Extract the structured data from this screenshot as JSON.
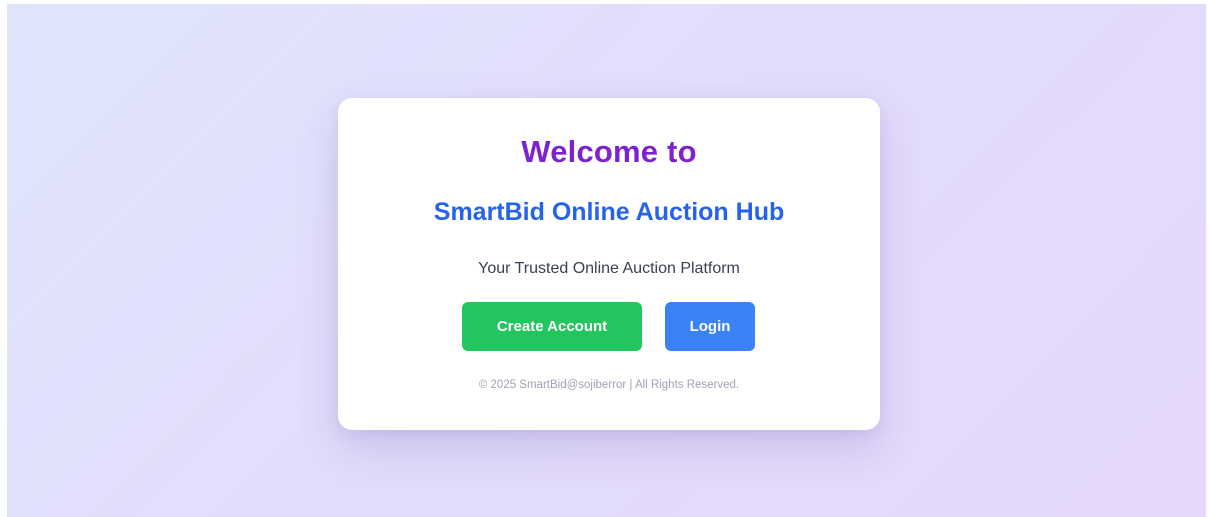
{
  "card": {
    "welcome": "Welcome to",
    "brand": "SmartBid Online Auction Hub",
    "tagline": "Your Trusted Online Auction Platform",
    "create_account_label": "Create Account",
    "login_label": "Login",
    "footer": "© 2025 SmartBid@sojiberror | All Rights Reserved."
  },
  "colors": {
    "welcome_text": "#7e22ce",
    "brand_text": "#2563eb",
    "create_button": "#22c55e",
    "login_button": "#3b82f6"
  }
}
